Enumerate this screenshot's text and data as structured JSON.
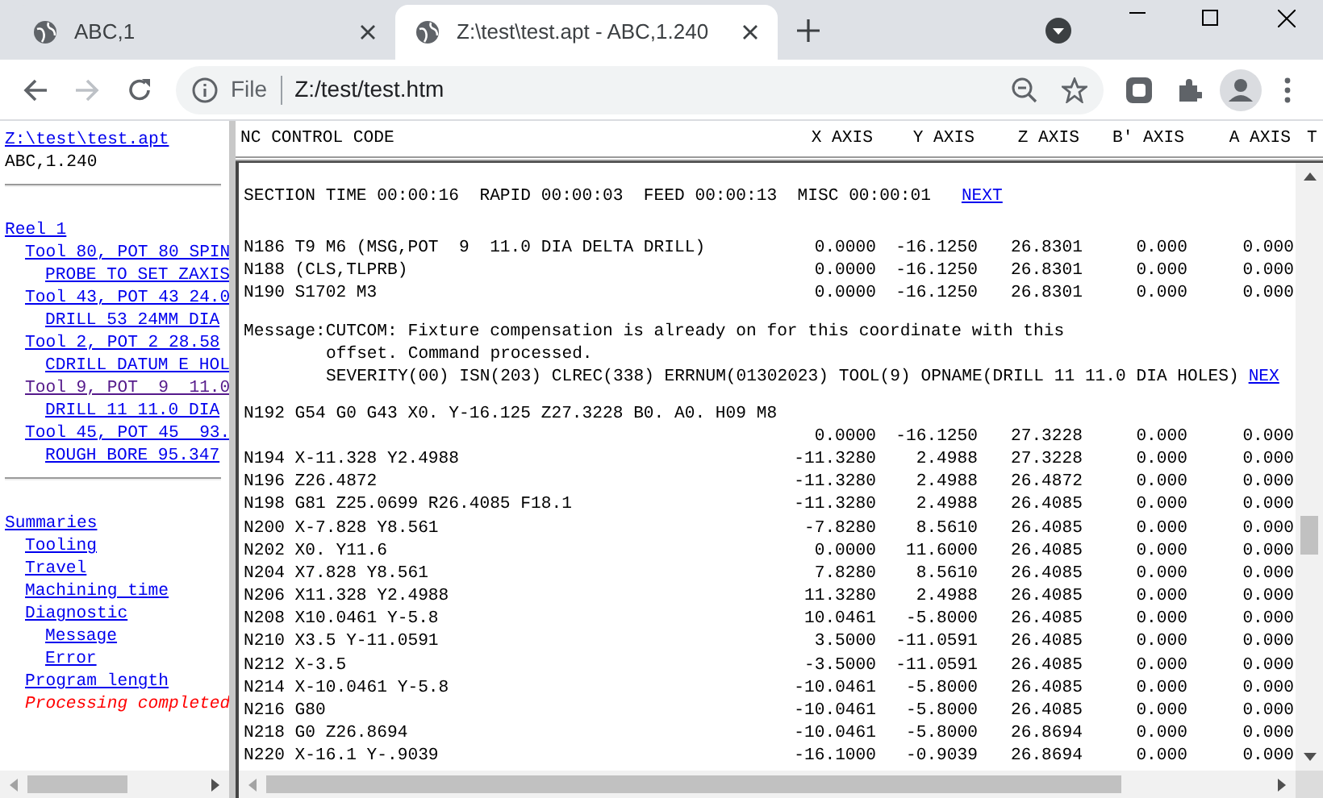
{
  "browser": {
    "tabs": [
      {
        "title": "ABC,1",
        "selected": false
      },
      {
        "title": "Z:\\test\\test.apt - ABC,1.240",
        "selected": true
      }
    ],
    "address": {
      "scheme": "File",
      "url": "Z:/test/test.htm"
    }
  },
  "left_frame": {
    "file_link": "Z:\\test\\test.apt",
    "version": "ABC,1.240",
    "reels": [
      {
        "label": "Reel 1",
        "children": [
          {
            "label": "Tool 80, POT 80 SPIN",
            "visited": false,
            "children": [
              {
                "label": "PROBE TO SET ZAXIS"
              }
            ]
          },
          {
            "label": "Tool 43, POT 43 24.0",
            "visited": false,
            "children": [
              {
                "label": "DRILL 53 24MM DIA"
              }
            ]
          },
          {
            "label": "Tool 2, POT 2 28.58",
            "visited": false,
            "children": [
              {
                "label": "CDRILL DATUM E HOL"
              }
            ]
          },
          {
            "label": "Tool 9, POT  9  11.0",
            "visited": true,
            "children": [
              {
                "label": "DRILL 11 11.0 DIA"
              }
            ]
          },
          {
            "label": "Tool 45, POT 45  93.",
            "visited": false,
            "children": [
              {
                "label": "ROUGH BORE 95.347"
              }
            ]
          }
        ]
      }
    ],
    "summaries": {
      "label": "Summaries",
      "children": [
        {
          "label": "Tooling"
        },
        {
          "label": "Travel"
        },
        {
          "label": "Machining time"
        },
        {
          "label": "Diagnostic",
          "children": [
            {
              "label": "Message"
            },
            {
              "label": "Error"
            }
          ]
        },
        {
          "label": "Program length"
        }
      ]
    },
    "status": "Processing completed"
  },
  "right_frame": {
    "columns": [
      "NC CONTROL CODE",
      "X AXIS",
      "Y AXIS",
      "Z AXIS",
      "B' AXIS",
      "A AXIS",
      "T"
    ],
    "blocks": [
      {
        "kind": "section",
        "text": "SECTION TIME 00:00:16  RAPID 00:00:03  FEED 00:00:13  MISC 00:00:01",
        "link": "NEXT"
      },
      {
        "kind": "rows",
        "rows": [
          [
            "N186 T9 M6 (MSG,POT  9  11.0 DIA DELTA DRILL)",
            "0.0000",
            "-16.1250",
            "26.8301",
            "0.000",
            "0.000"
          ],
          [
            "N188 (CLS,TLPRB)",
            "0.0000",
            "-16.1250",
            "26.8301",
            "0.000",
            "0.000"
          ],
          [
            "N190 S1702 M3",
            "0.0000",
            "-16.1250",
            "26.8301",
            "0.000",
            "0.000"
          ]
        ]
      },
      {
        "kind": "message",
        "lines": [
          "Message:CUTCOM: Fixture compensation is already on for this coordinate with this",
          "offset. Command processed.",
          "SEVERITY(00) ISN(203) CLREC(338) ERRNUM(01302023) TOOL(9) OPNAME(DRILL 11 11.0 DIA HOLES)"
        ],
        "link": "NEX"
      },
      {
        "kind": "rows",
        "rows": [
          [
            "N192 G54 G0 G43 X0. Y-16.125 Z27.3228 B0. A0. H09 M8"
          ],
          [
            "",
            "0.0000",
            "-16.1250",
            "27.3228",
            "0.000",
            "0.000"
          ],
          [
            "N194 X-11.328 Y2.4988",
            "-11.3280",
            "2.4988",
            "27.3228",
            "0.000",
            "0.000"
          ],
          [
            "N196 Z26.4872",
            "-11.3280",
            "2.4988",
            "26.4872",
            "0.000",
            "0.000"
          ],
          [
            "N198 G81 Z25.0699 R26.4085 F18.1",
            "-11.3280",
            "2.4988",
            "26.4085",
            "0.000",
            "0.000"
          ],
          [
            "N200 X-7.828 Y8.561",
            "-7.8280",
            "8.5610",
            "26.4085",
            "0.000",
            "0.000"
          ],
          [
            "N202 X0. Y11.6",
            "0.0000",
            "11.6000",
            "26.4085",
            "0.000",
            "0.000"
          ],
          [
            "N204 X7.828 Y8.561",
            "7.8280",
            "8.5610",
            "26.4085",
            "0.000",
            "0.000"
          ],
          [
            "N206 X11.328 Y2.4988",
            "11.3280",
            "2.4988",
            "26.4085",
            "0.000",
            "0.000"
          ],
          [
            "N208 X10.0461 Y-5.8",
            "10.0461",
            "-5.8000",
            "26.4085",
            "0.000",
            "0.000"
          ],
          [
            "N210 X3.5 Y-11.0591",
            "3.5000",
            "-11.0591",
            "26.4085",
            "0.000",
            "0.000"
          ],
          [
            "N212 X-3.5",
            "-3.5000",
            "-11.0591",
            "26.4085",
            "0.000",
            "0.000"
          ],
          [
            "N214 X-10.0461 Y-5.8",
            "-10.0461",
            "-5.8000",
            "26.4085",
            "0.000",
            "0.000"
          ],
          [
            "N216 G80",
            "-10.0461",
            "-5.8000",
            "26.4085",
            "0.000",
            "0.000"
          ],
          [
            "N218 G0 Z26.8694",
            "-10.0461",
            "-5.8000",
            "26.8694",
            "0.000",
            "0.000"
          ],
          [
            "N220 X-16.1 Y-.9039",
            "-16.1000",
            "-0.9039",
            "26.8694",
            "0.000",
            "0.000"
          ]
        ]
      }
    ]
  }
}
